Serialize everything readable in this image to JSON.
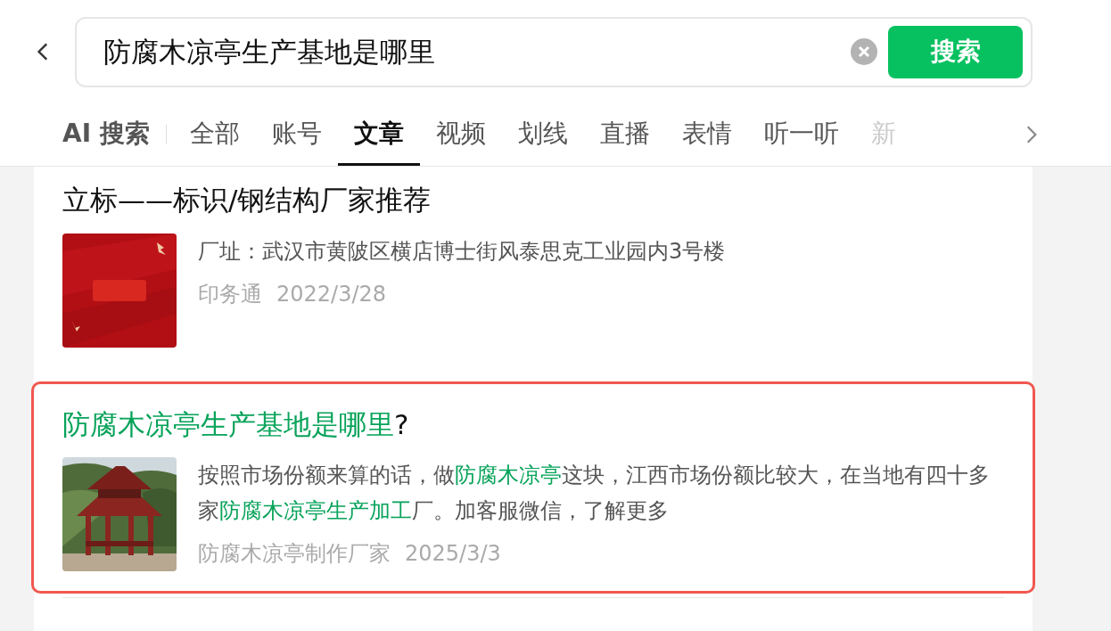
{
  "search": {
    "value": "防腐木凉亭生产基地是哪里",
    "button": "搜索"
  },
  "tabs": [
    {
      "label": "AI 搜索",
      "selected": false,
      "faded": false
    },
    {
      "label": "全部",
      "selected": false,
      "faded": false
    },
    {
      "label": "账号",
      "selected": false,
      "faded": false
    },
    {
      "label": "文章",
      "selected": true,
      "faded": false
    },
    {
      "label": "视频",
      "selected": false,
      "faded": false
    },
    {
      "label": "划线",
      "selected": false,
      "faded": false
    },
    {
      "label": "直播",
      "selected": false,
      "faded": false
    },
    {
      "label": "表情",
      "selected": false,
      "faded": false
    },
    {
      "label": "听一听",
      "selected": false,
      "faded": false
    },
    {
      "label": "新",
      "selected": false,
      "faded": true
    }
  ],
  "results": [
    {
      "title": [
        {
          "text": "立标——标识/钢结构厂家推荐",
          "highlight": false
        }
      ],
      "snippet": [
        {
          "text": "厂址：武汉市黄陂区横店博士街风泰思克工业园内3号楼",
          "highlight": false
        }
      ],
      "source": "印务通",
      "date": "2022/3/28",
      "thumb": {
        "kind": "picture"
      },
      "outlined": false
    },
    {
      "title": [
        {
          "text": "防腐木凉亭生产基地是哪里",
          "highlight": true
        },
        {
          "text": "?",
          "highlight": false
        }
      ],
      "snippet": [
        {
          "text": "按照市场份额来算的话，做",
          "highlight": false
        },
        {
          "text": "防腐木凉亭",
          "highlight": true
        },
        {
          "text": "这块，江西市场份额比较大，在当地有四十多家",
          "highlight": false
        },
        {
          "text": "防腐木凉亭生产加工",
          "highlight": true
        },
        {
          "text": "厂。加客服微信，了解更多",
          "highlight": false
        }
      ],
      "source": "防腐木凉亭制作厂家",
      "date": "2025/3/3",
      "thumb": {
        "kind": "picture"
      },
      "outlined": true
    }
  ]
}
